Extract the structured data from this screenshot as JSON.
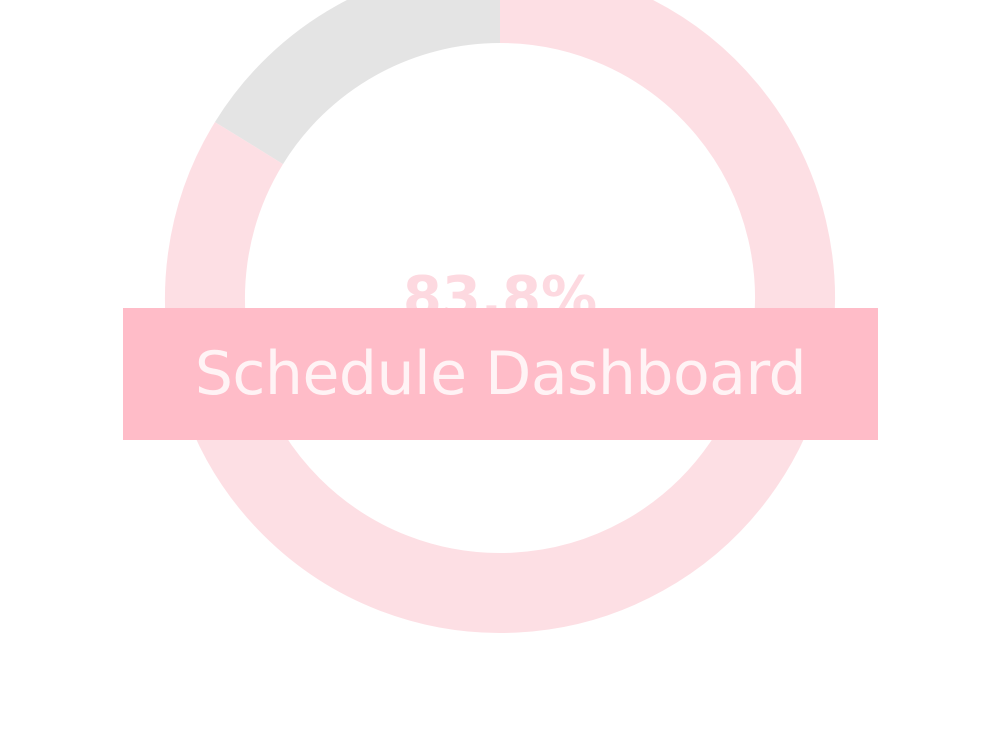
{
  "dashboard": {
    "title": "Schedule Dashboard",
    "donut": {
      "value_label": "83.8%",
      "percent": 83.8
    }
  },
  "colors": {
    "banner_bg": "#FFBCC8",
    "banner_text": "#FFF3F5",
    "ring_fill": "#FDDFE4",
    "ring_remainder": "#E4E4E4",
    "value_text": "#FDD9E0"
  }
}
